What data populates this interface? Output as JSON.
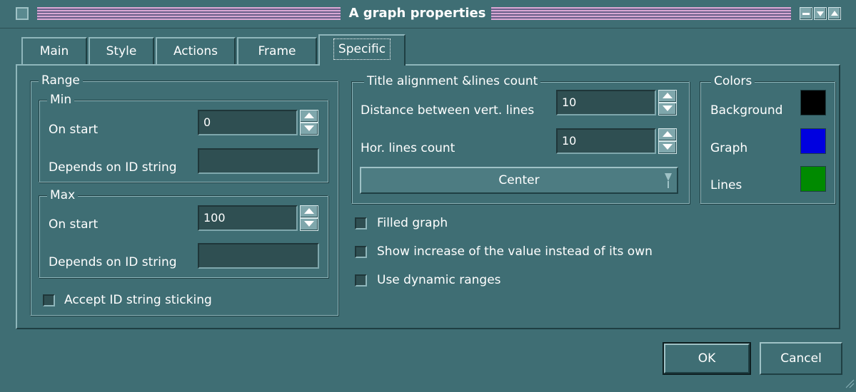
{
  "window": {
    "title": "A graph properties"
  },
  "tabs": [
    {
      "label": "Main",
      "active": false
    },
    {
      "label": "Style",
      "active": false
    },
    {
      "label": "Actions",
      "active": false
    },
    {
      "label": "Frame",
      "active": false
    },
    {
      "label": "Specific",
      "active": true
    }
  ],
  "range": {
    "legend": "Range",
    "min": {
      "legend": "Min",
      "on_start_label": "On start",
      "on_start_value": "0",
      "depends_label": "Depends on ID string",
      "depends_value": ""
    },
    "max": {
      "legend": "Max",
      "on_start_label": "On start",
      "on_start_value": "100",
      "depends_label": "Depends on ID string",
      "depends_value": ""
    },
    "accept_sticking_label": "Accept ID string sticking",
    "accept_sticking_checked": false
  },
  "title_alignment": {
    "legend": "Title alignment &lines count",
    "vert_lines_label": "Distance between vert. lines",
    "vert_lines_value": "10",
    "hor_lines_label": "Hor. lines count",
    "hor_lines_value": "10",
    "alignment_value": "Center"
  },
  "colors": {
    "legend": "Colors",
    "items": [
      {
        "label": "Background",
        "color": "#000000"
      },
      {
        "label": "Graph",
        "color": "#0000e0"
      },
      {
        "label": "Lines",
        "color": "#008a00"
      }
    ]
  },
  "options": [
    {
      "label": "Filled graph",
      "checked": false
    },
    {
      "label": "Show increase of the value instead of its own",
      "checked": false
    },
    {
      "label": "Use dynamic ranges",
      "checked": false
    }
  ],
  "buttons": {
    "ok": "OK",
    "cancel": "Cancel"
  }
}
